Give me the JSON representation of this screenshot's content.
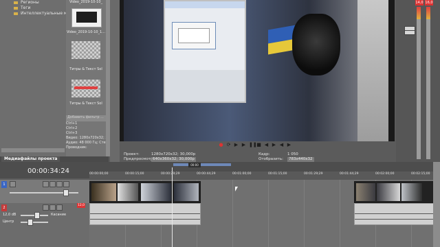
{
  "explorer": {
    "tree_items": [
      "Регионы",
      "Теги",
      "Интеллектуальные ман"
    ]
  },
  "media": {
    "items": [
      {
        "label": "Video_2019-10-10_"
      },
      {
        "label": "Video_2019-10-10_1..."
      },
      {
        "label": "Титры & Текст Sol"
      },
      {
        "label": "Титры & Текст Sol"
      }
    ],
    "search_placeholder": "Добавить фильтр ...",
    "shortcuts": [
      "Ctrl+1",
      "Ctrl+2",
      "Ctrl+3"
    ],
    "properties": [
      "Видео: 1280x720x32; 30",
      "Аудио: 48 000 Гц; Стер",
      "Проводник:"
    ],
    "tab_label": "Медиафайлы проекта"
  },
  "preview": {
    "project_label": "Проект:",
    "project_value": "1280x720x32; 30,000p",
    "preview_label": "Предпросмотр:",
    "preview_value": "640x360x32; 30,000p",
    "frame_label": "Кадр:",
    "frame_value": "1 050",
    "display_label": "Отобразить:",
    "display_value": "783x440x32"
  },
  "transport": {
    "buttons": [
      "record",
      "loop",
      "play",
      "play-from-start",
      "pause",
      "stop",
      "prev-marker",
      "next-marker",
      "prev-frame",
      "next-frame"
    ]
  },
  "meters": {
    "peak_left": "14,0",
    "peak_right": "16,0",
    "accent": "#d33333"
  },
  "timeline": {
    "timecode": "00:00:34:24",
    "ruler": [
      "00:00:00;00",
      "00:00:15;00",
      "00:00:29;29",
      "00:00:44;29",
      "00:01:00;00",
      "00:01:15;00",
      "00:01:29;29",
      "00:01:44;29",
      "00:02:00;00",
      "00:02:15;00"
    ],
    "loop_label": "00:00",
    "audio_level": "12,0 dB",
    "audio_mode": "Касание",
    "pan_label": "Центр",
    "audio_peak": "12,0"
  }
}
